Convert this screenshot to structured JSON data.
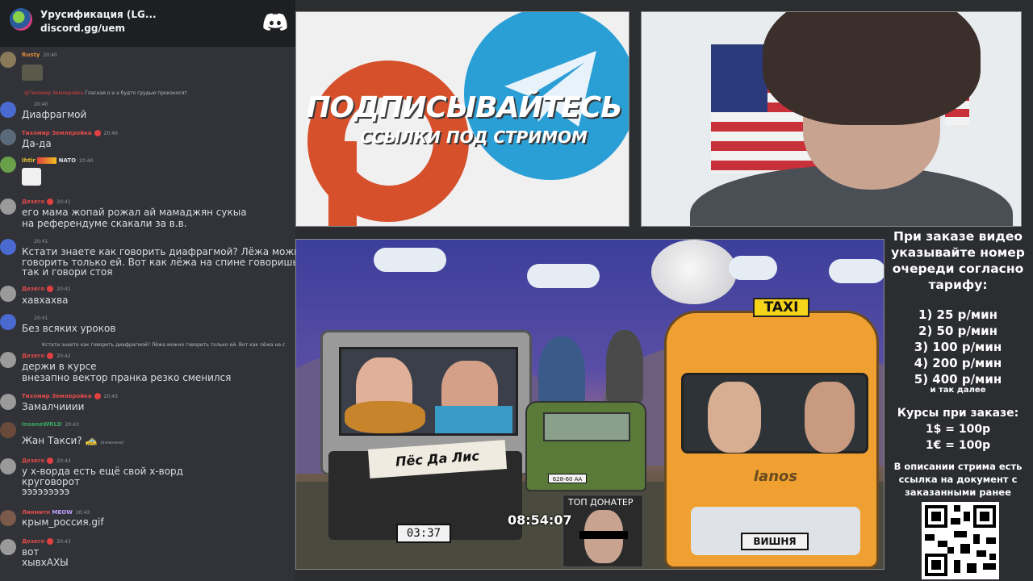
{
  "discord": {
    "server_name": "Урусификация (LG...",
    "server_invite": "discord.gg/uem"
  },
  "chat": {
    "messages": [
      {
        "author": "Rusty",
        "time": "20:40",
        "author_color": "#e08a3a",
        "text": "",
        "emoji": true
      },
      {
        "reply_name": "@Тихомир Землеройка",
        "reply_text": "Гласная о и а будто грудью произносят",
        "author": "",
        "time": "20:40",
        "text": "Диафрагмой"
      },
      {
        "author": "Тихомир Землеройка",
        "time": "20:40",
        "author_color": "#e04b4b",
        "text": "Да-да"
      },
      {
        "author": "Ihtir",
        "time": "20:40",
        "author_color": "#e0c030",
        "badge_text": "NATO",
        "text": "",
        "emoji": true
      },
      {
        "author": "Дезего",
        "time": "20:41",
        "author_color": "#e04b4b",
        "text": "его мама жопай рожал ай мамаджян сукыа",
        "text2": "на референдуме скакали за  в.в."
      },
      {
        "author": "",
        "time": "20:41",
        "text": "Кстати знаете как говорить диафрагмой? Лёжа можно",
        "text2": "говорить только ей. Вот как лёжа на спине говоришь -",
        "text3": "так и говори стоя"
      },
      {
        "author": "Дезего",
        "time": "20:41",
        "author_color": "#e04b4b",
        "text": "хавхахва"
      },
      {
        "author": "",
        "time": "20:41",
        "text": "Без всяких уроков"
      },
      {
        "reply_text": "Кстати знаете как говорить диафрагмой? Лёжа можно говорить только ей. Вот как лёжа на с",
        "author": "Дезего",
        "time": "20:42",
        "author_color": "#e04b4b",
        "text": "держи в курсе",
        "text2": "внезапно вектор пранка резко сменился"
      },
      {
        "author": "Тихомир Землеройка",
        "time": "20:43",
        "author_color": "#e04b4b",
        "text": "Замалчииии"
      },
      {
        "author": "InsaneWRLD",
        "time": "20:43",
        "author_color": "#3ba55c",
        "text": "Жан Такси? 🚕",
        "edited": "(изменено)"
      },
      {
        "author": "Дезего",
        "time": "20:43",
        "author_color": "#e04b4b",
        "text": "у х-ворда есть ещё свой х-ворд",
        "text2": "круговорот",
        "text3": "эээээээээ"
      },
      {
        "author": "Линмитн",
        "time": "20:43",
        "author_color": "#e04b4b",
        "badge_text": "MEOW",
        "text": "крым_россия.gif"
      },
      {
        "author": "Дезего",
        "time": "20:43",
        "author_color": "#e04b4b",
        "text": "вот",
        "text2": "хывхАХЫ"
      }
    ]
  },
  "promo": {
    "headline": "ПОДПИСЫВАЙТЕСЬ",
    "subline": "ССЫЛКИ ПОД СТРИМОМ"
  },
  "scene": {
    "truck_sign": "Пёс Да Лис",
    "truck_plate": "03:37",
    "niva_plate": "628-60 АА",
    "taxi_sign": "TAXI",
    "taxi_brand": "lanos",
    "taxi_plate": "ВИШНЯ",
    "top_donor_label": "ТОП ДОНАТЕР",
    "stream_timer": "08:54:07"
  },
  "info": {
    "intro": "При заказе видео указывайте номер очереди согласно тарифу:",
    "tariffs": [
      "1) 25 р/мин",
      "2) 50 р/мин",
      "3) 100 р/мин",
      "4) 200 р/мин",
      "5) 400 р/мин"
    ],
    "tariffs_more": "и так далее",
    "rates_title": "Курсы при заказе:",
    "rates": [
      "1$ = 100р",
      "1€ = 100р"
    ],
    "description": "В описании стрима есть ссылка на документ с заказанными ранее видео"
  },
  "colors": {
    "discord_bg": "#313338",
    "discord_header": "#1e1f22",
    "page_bg": "#2b2d31",
    "accent_red": "#e04b4b"
  }
}
